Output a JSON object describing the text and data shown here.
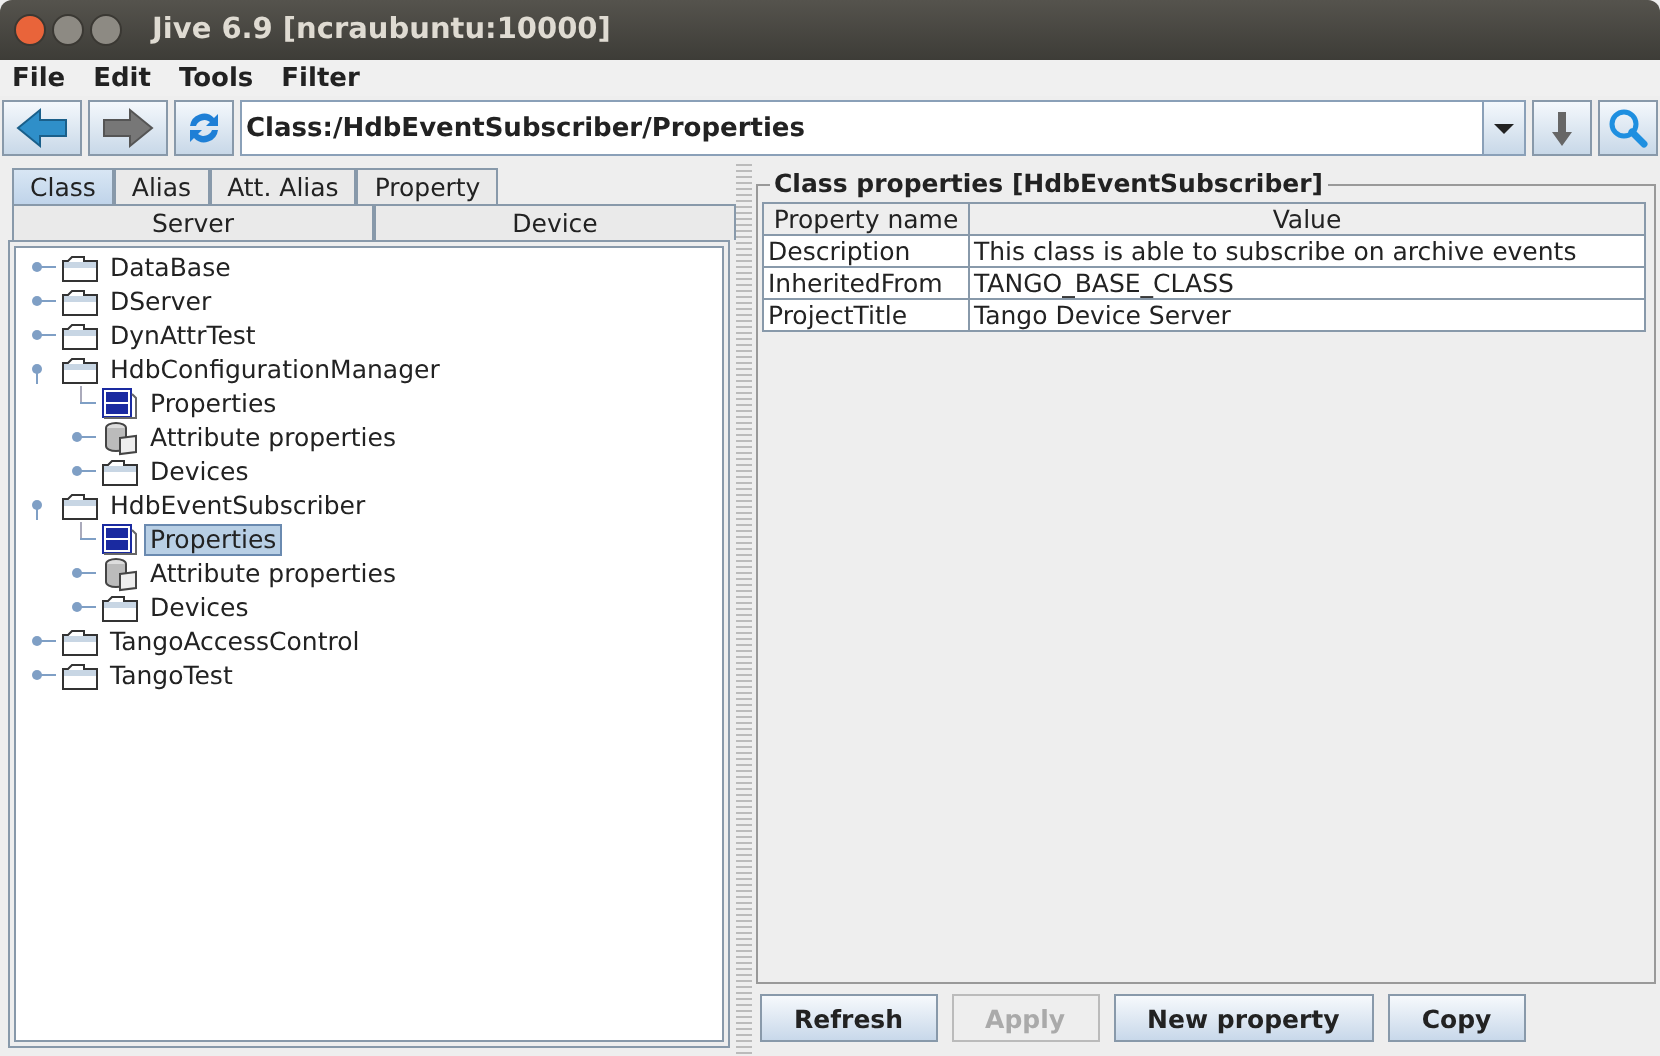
{
  "window": {
    "title": "Jive 6.9  [ncraubuntu:10000]"
  },
  "menu": [
    "File",
    "Edit",
    "Tools",
    "Filter"
  ],
  "toolbar": {
    "path": "Class:/HdbEventSubscriber/Properties"
  },
  "tabs": [
    [
      {
        "label": "Class",
        "selected": true
      },
      {
        "label": "Alias",
        "selected": false
      },
      {
        "label": "Att. Alias",
        "selected": false
      },
      {
        "label": "Property",
        "selected": false
      }
    ],
    [
      {
        "label": "Server",
        "selected": false
      },
      {
        "label": "Device",
        "selected": false
      }
    ]
  ],
  "tree": [
    {
      "label": "DataBase",
      "kind": "folder",
      "expanded": false,
      "selected": false
    },
    {
      "label": "DServer",
      "kind": "folder",
      "expanded": false,
      "selected": false
    },
    {
      "label": "DynAttrTest",
      "kind": "folder",
      "expanded": false,
      "selected": false
    },
    {
      "label": "HdbConfigurationManager",
      "kind": "folder",
      "expanded": true,
      "selected": false,
      "children": [
        {
          "label": "Properties",
          "kind": "properties",
          "selected": false
        },
        {
          "label": "Attribute properties",
          "kind": "attributes",
          "expanded": false,
          "selected": false
        },
        {
          "label": "Devices",
          "kind": "folder",
          "expanded": false,
          "selected": false
        }
      ]
    },
    {
      "label": "HdbEventSubscriber",
      "kind": "folder",
      "expanded": true,
      "selected": false,
      "children": [
        {
          "label": "Properties",
          "kind": "properties",
          "selected": true
        },
        {
          "label": "Attribute properties",
          "kind": "attributes",
          "expanded": false,
          "selected": false
        },
        {
          "label": "Devices",
          "kind": "folder",
          "expanded": false,
          "selected": false
        }
      ]
    },
    {
      "label": "TangoAccessControl",
      "kind": "folder",
      "expanded": false,
      "selected": false
    },
    {
      "label": "TangoTest",
      "kind": "folder",
      "expanded": false,
      "selected": false
    }
  ],
  "panel": {
    "title": "Class properties [HdbEventSubscriber]",
    "columns": [
      "Property name",
      "Value"
    ],
    "rows": [
      [
        "Description",
        "This class is able to subscribe on archive events"
      ],
      [
        "InheritedFrom",
        "TANGO_BASE_CLASS"
      ],
      [
        "ProjectTitle",
        "Tango Device Server"
      ]
    ]
  },
  "buttons": [
    {
      "label": "Refresh",
      "disabled": false
    },
    {
      "label": "Apply",
      "disabled": true
    },
    {
      "label": "New property",
      "disabled": false
    },
    {
      "label": "Copy",
      "disabled": false
    }
  ]
}
